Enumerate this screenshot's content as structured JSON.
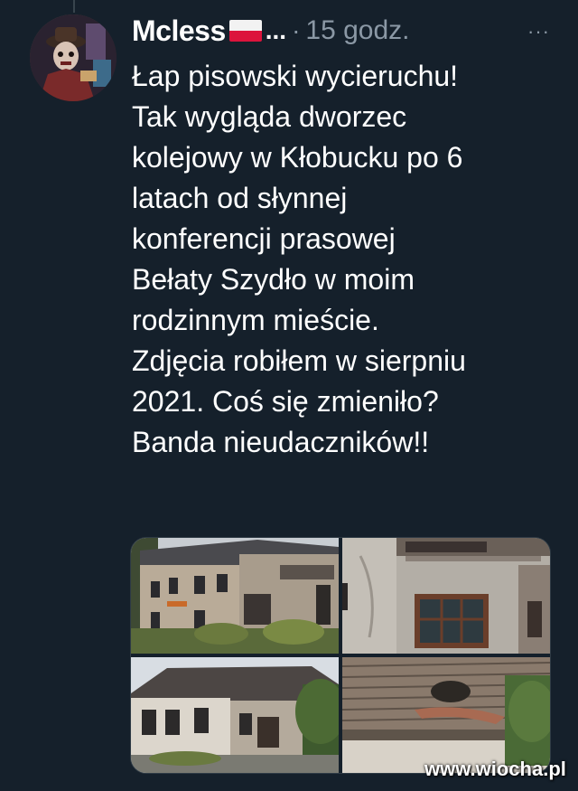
{
  "tweet": {
    "author_name": "Mcless",
    "author_truncated": "...",
    "separator": "·",
    "timestamp": "15 godz.",
    "more_label": "···",
    "text_lines": [
      "Łap pisowski wycieruchu!",
      "Tak wygląda dworzec",
      "kolejowy w Kłobucku po 6",
      "latach od słynnej",
      "konferencji prasowej",
      "Bełaty Szydło w moim",
      "rodzinnym mieście.",
      "Zdjęcia robiłem w sierpniu",
      "2021. Coś się zmieniło?",
      "Banda nieudaczników!!"
    ],
    "media": [
      {
        "name": "photo-station-facade"
      },
      {
        "name": "photo-boarded-window"
      },
      {
        "name": "photo-station-side"
      },
      {
        "name": "photo-damaged-roof"
      }
    ]
  },
  "watermark": "www.wiocha.pl",
  "colors": {
    "background": "#15202b",
    "text": "#ffffff",
    "muted": "#8b98a5",
    "flag_white": "#f2f2f2",
    "flag_red": "#dc143c"
  }
}
